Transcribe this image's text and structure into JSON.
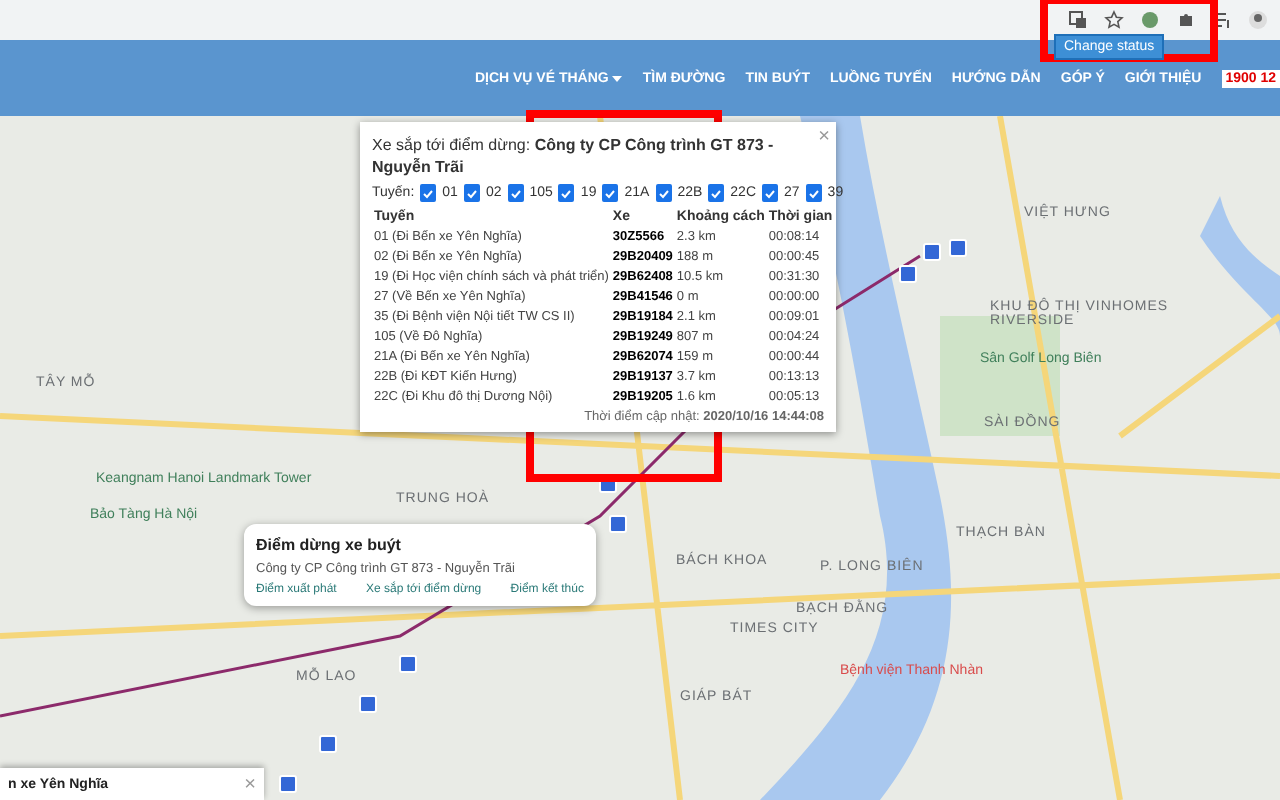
{
  "browser": {
    "tooltip": "Change status"
  },
  "nav": {
    "items": [
      {
        "label": "DỊCH VỤ VÉ THÁNG",
        "dropdown": true
      },
      {
        "label": "TÌM ĐƯỜNG",
        "dropdown": false
      },
      {
        "label": "TIN BUÝT",
        "dropdown": false
      },
      {
        "label": "LUỒNG TUYẾN",
        "dropdown": false
      },
      {
        "label": "HƯỚNG DẪN",
        "dropdown": false
      },
      {
        "label": "GÓP Ý",
        "dropdown": false
      },
      {
        "label": "GIỚI THIỆU",
        "dropdown": false
      }
    ],
    "hotline": "1900 12"
  },
  "map_labels": [
    {
      "text": "TRUNG HOÀ",
      "kind": "area"
    },
    {
      "text": "BÁCH KHOA",
      "kind": "area"
    },
    {
      "text": "TIMES CITY",
      "kind": "area"
    },
    {
      "text": "GIÁP BÁT",
      "kind": "area"
    },
    {
      "text": "MỖ LAO",
      "kind": "area"
    },
    {
      "text": "TÂY MỖ",
      "kind": "area"
    },
    {
      "text": "VIỆT HƯNG",
      "kind": "area"
    },
    {
      "text": "SÀI ĐỒNG",
      "kind": "area"
    },
    {
      "text": "THẠCH BÀN",
      "kind": "area"
    },
    {
      "text": "P. LONG BIÊN",
      "kind": "area"
    },
    {
      "text": "BẠCH ĐẰNG",
      "kind": "area"
    },
    {
      "text": "KHU ĐÔ THỊ VINHOMES RIVERSIDE",
      "kind": "area"
    },
    {
      "text": "Sân Golf Long Biên",
      "kind": "place"
    },
    {
      "text": "Bệnh viện Thanh Nhàn",
      "kind": "hospital"
    },
    {
      "text": "Keangnam Hanoi Landmark Tower",
      "kind": "place"
    },
    {
      "text": "Bảo Tàng Hà Nội",
      "kind": "place"
    }
  ],
  "arrivals": {
    "title": "Xe sắp tới điểm dừng: **Công ty CP Công trình GT 873 - Nguyễn Trãi**",
    "close": "×",
    "routes_label": "Tuyến:",
    "routes": [
      {
        "label": "01",
        "checked": true
      },
      {
        "label": "02",
        "checked": true
      },
      {
        "label": "105",
        "checked": true
      },
      {
        "label": "19",
        "checked": true
      },
      {
        "label": "21A",
        "checked": true
      },
      {
        "label": "22B",
        "checked": true
      },
      {
        "label": "22C",
        "checked": true
      },
      {
        "label": "27",
        "checked": true
      },
      {
        "label": "39",
        "checked": true
      }
    ],
    "columns": [
      "Tuyến",
      "Xe",
      "Khoảng cách",
      "Thời gian"
    ],
    "rows": [
      [
        "01 (Đi Bến xe Yên Nghĩa)",
        "30Z5566",
        "2.3 km",
        "00:08:14"
      ],
      [
        "02 (Đi Bến xe Yên Nghĩa)",
        "29B20409",
        "188 m",
        "00:00:45"
      ],
      [
        "19 (Đi Học viện chính sách và phát triển)",
        "29B62408",
        "10.5 km",
        "00:31:30"
      ],
      [
        "27 (Về Bến xe Yên Nghĩa)",
        "29B41546",
        "0 m",
        "00:00:00"
      ],
      [
        "35 (Đi Bệnh viện Nội tiết TW CS II)",
        "29B19184",
        "2.1 km",
        "00:09:01"
      ],
      [
        "105 (Về Đô Nghĩa)",
        "29B19249",
        "807 m",
        "00:04:24"
      ],
      [
        "21A (Đi Bến xe Yên Nghĩa)",
        "29B62074",
        "159 m",
        "00:00:44"
      ],
      [
        "22B (Đi KĐT Kiến Hưng)",
        "29B19137",
        "3.7 km",
        "00:13:13"
      ],
      [
        "22C (Đi Khu đô thị Dương Nội)",
        "29B19205",
        "1.6 km",
        "00:05:13"
      ]
    ],
    "updated_label": "Thời điểm cập nhật:",
    "updated": "2020/10/16 14:44:08"
  },
  "stop": {
    "title": "Điểm dừng xe buýt",
    "name": "Công ty CP Công trình GT 873 - Nguyễn Trãi",
    "links": [
      "Điểm xuất phát",
      "Xe sắp tới điểm dừng",
      "Điểm kết thúc"
    ]
  },
  "bottom_panel": {
    "title": "n xe Yên Nghĩa",
    "close": "×"
  }
}
